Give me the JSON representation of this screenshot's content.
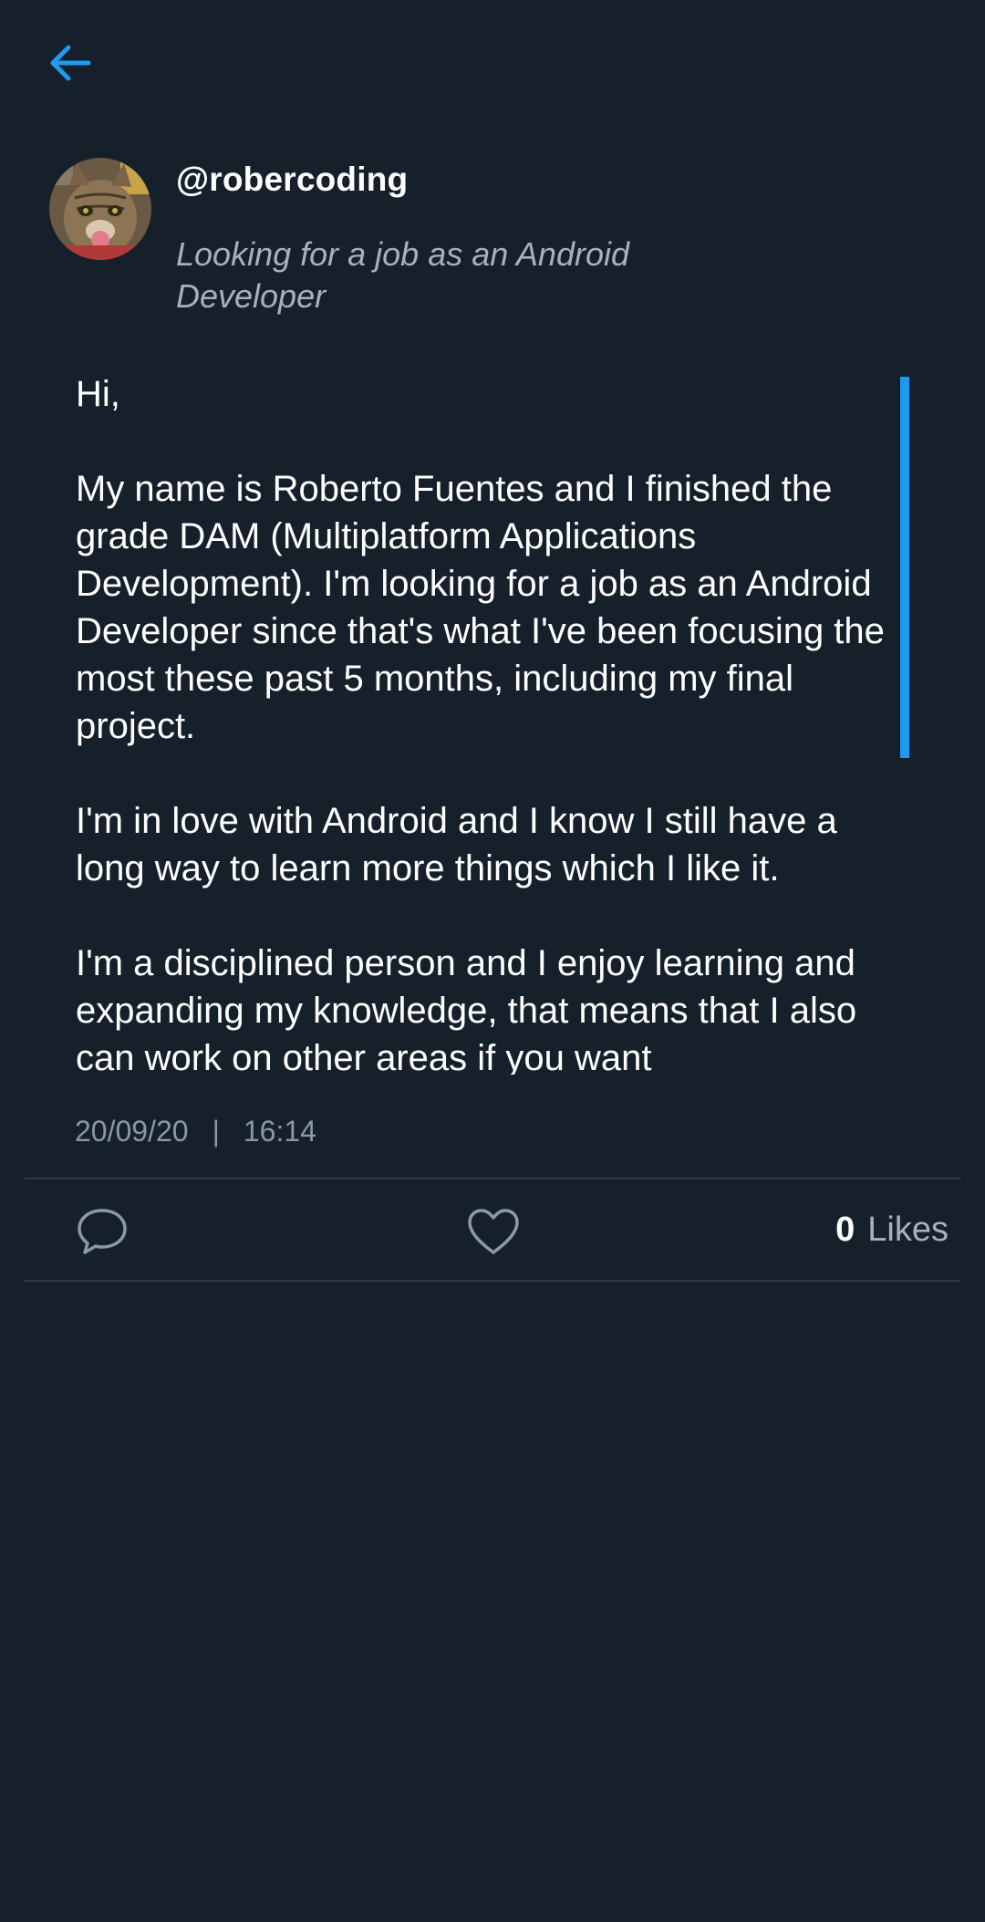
{
  "colors": {
    "background": "#15202b",
    "accent": "#1d9bf0",
    "text_primary": "#ffffff",
    "text_secondary": "#a7b1bc",
    "divider": "#2f3b47"
  },
  "header": {
    "back_icon": "arrow-left-icon"
  },
  "author": {
    "username": "@robercoding",
    "bio": "Looking for a job as an Android Developer",
    "avatar": "cat-avatar"
  },
  "post": {
    "paragraphs": [
      "Hi,",
      "My name is Roberto Fuentes and I finished the grade DAM (Multiplatform Applications Development). I'm looking for a job as an Android Developer since that's what I've been focusing the most these past 5 months, including my final project.",
      "I'm in love with Android and I know I still have a long way to learn more things which I like it.",
      "I'm a disciplined person and I enjoy learning and expanding my knowledge, that means that I also can work on other areas if you want"
    ],
    "date": "20/09/20",
    "separator": "|",
    "time": "16:14"
  },
  "actions": {
    "comment_icon": "comment-icon",
    "like_icon": "heart-icon",
    "likes_count": "0",
    "likes_label": "Likes"
  }
}
